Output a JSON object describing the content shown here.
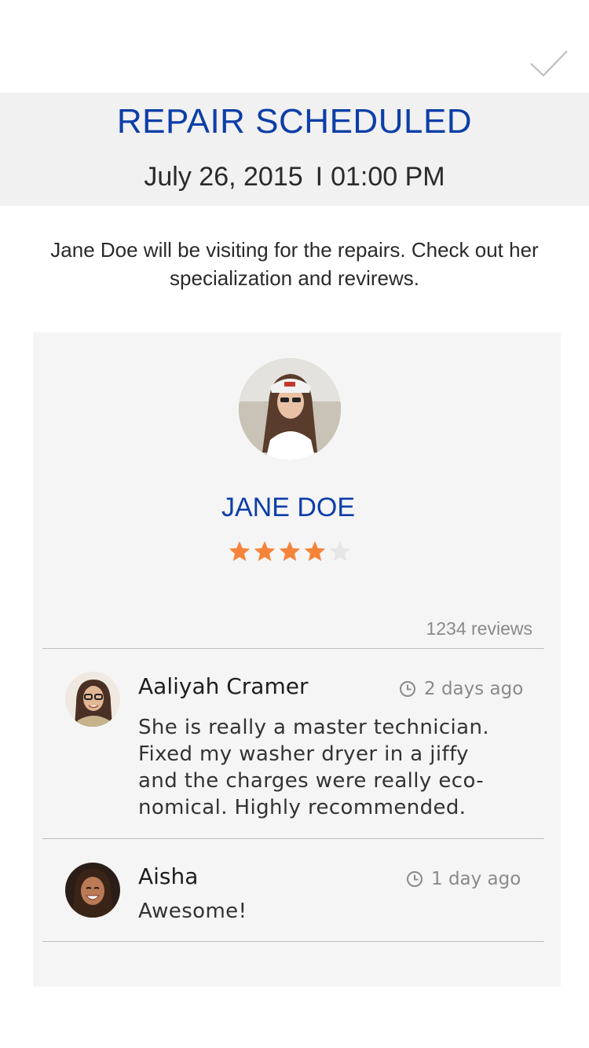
{
  "header": {
    "title": "REPAIR SCHEDULED",
    "date": "July 26, 2015",
    "separator": "I",
    "time": "01:00 PM"
  },
  "intro": "Jane Doe will be visiting for the repairs. Check out her specialization and revirews.",
  "technician": {
    "name": "JANE DOE",
    "rating": 4,
    "max_rating": 5,
    "reviews_label": "1234 reviews"
  },
  "reviews": [
    {
      "name": "Aaliyah Cramer",
      "time": "2 days ago",
      "text_lines": [
        "She is really a master technician.",
        "Fixed my washer dryer in a jiffy",
        "and the charges were really eco-",
        "nomical. Highly recommended."
      ]
    },
    {
      "name": "Aisha",
      "time": "1 day ago",
      "text_lines": [
        "Awesome!"
      ]
    }
  ],
  "colors": {
    "accent": "#0d3ea8",
    "star_filled": "#f5843a",
    "star_empty": "#e6e6e6"
  },
  "icons": {
    "confirm": "checkmark-icon",
    "time": "clock-icon",
    "rating": "star-icon"
  }
}
